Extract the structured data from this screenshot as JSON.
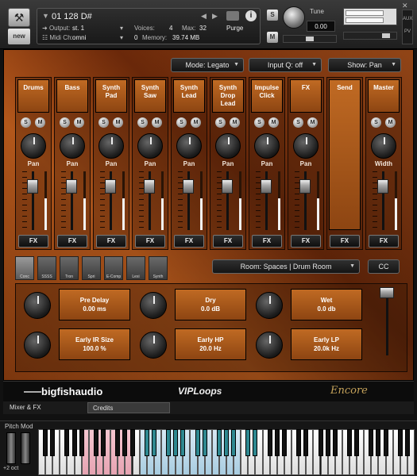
{
  "header": {
    "instrument_name": "01 128 D#",
    "output_label": "Output:",
    "output_value": "st. 1",
    "midi_label": "Midi Ch:",
    "midi_value": "omni",
    "voices_label": "Voices:",
    "voices_value": "4",
    "max_label": "Max:",
    "max_value": "32",
    "purge_label": "Purge",
    "memory_label": "Memory:",
    "memory_value": "39.74 MB",
    "memory_prefix": "0",
    "tune_label": "Tune",
    "tune_value": "0.00",
    "solo_label": "S",
    "mute_label": "M",
    "new_badge": "new",
    "aux_label": "AUX",
    "pv_label": "PV"
  },
  "toolbar": {
    "mode": "Mode: Legato",
    "input_q": "Input Q: off",
    "show": "Show: Pan"
  },
  "channels": [
    {
      "name": "Drums",
      "control": "Pan",
      "fx": "FX"
    },
    {
      "name": "Bass",
      "control": "Pan",
      "fx": "FX"
    },
    {
      "name": "Synth Pad",
      "control": "Pan",
      "fx": "FX"
    },
    {
      "name": "Synth Saw",
      "control": "Pan",
      "fx": "FX"
    },
    {
      "name": "Synth Lead",
      "control": "Pan",
      "fx": "FX"
    },
    {
      "name": "Synth Drop Lead",
      "control": "Pan",
      "fx": "FX"
    },
    {
      "name": "Impulse Click",
      "control": "Pan",
      "fx": "FX"
    },
    {
      "name": "FX",
      "control": "Pan",
      "fx": "FX"
    }
  ],
  "send": {
    "name": "Send",
    "fx": "FX"
  },
  "master": {
    "name": "Master",
    "control": "Width",
    "fx": "FX"
  },
  "channel_buttons": {
    "solo": "S",
    "mute": "M"
  },
  "reverb": {
    "room_types": [
      "Conc",
      "SSSS",
      "Tron",
      "Spri",
      "E-Comp",
      "Lexi",
      "Synth"
    ],
    "room": "Room: Spaces | Drum Room",
    "cc": "CC",
    "params": [
      {
        "name": "Pre Delay",
        "value": "0.00 ms"
      },
      {
        "name": "Dry",
        "value": "0.0 dB"
      },
      {
        "name": "Wet",
        "value": "0.0 db"
      },
      {
        "name": "Early IR Size",
        "value": "100.0 %"
      },
      {
        "name": "Early HP",
        "value": "20.0 Hz"
      },
      {
        "name": "Early LP",
        "value": "20.0k Hz"
      }
    ]
  },
  "brand": {
    "bigfish": "bigfishaudio",
    "viploops": "VIPLoops",
    "encore": "Encore"
  },
  "tabs": [
    "Mixer & FX",
    "Credits"
  ],
  "keyboard": {
    "pitch_mod": "Pitch Mod",
    "octave": "+2 oct"
  },
  "colors": {
    "accent_orange": "#b85a1c",
    "panel_dark": "#141414",
    "key_pink": "#f5c6d0",
    "key_blue": "#d8eaf5",
    "key_teal": "#2e8890"
  }
}
